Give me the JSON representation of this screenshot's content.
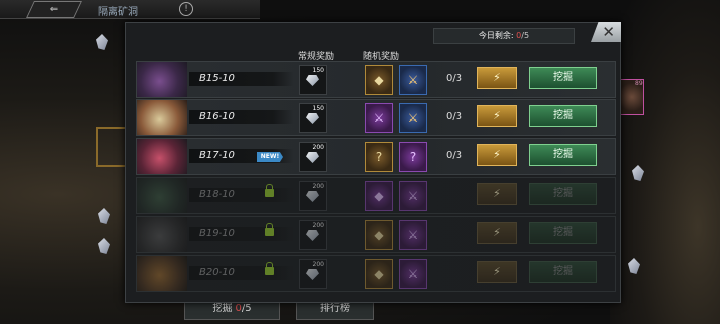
{
  "top_bar": {
    "back_label": "",
    "title": "隔离矿洞",
    "info_label": "!"
  },
  "bottom_buttons": {
    "dig_label": "挖掘",
    "dig_count": "/5",
    "rank_label": "排行榜"
  },
  "side_portrait": {
    "level": "89"
  },
  "modal": {
    "remaining_label": "今日剩余:",
    "remaining_current": "0",
    "remaining_total": "/5",
    "close_label": "✕",
    "col_normal": "常规奖励",
    "col_random": "随机奖励"
  },
  "rows": [
    {
      "name": "B15-10",
      "normal_qty": "150",
      "count": "0/3",
      "dig_label": "挖掘",
      "bolt": "⚡",
      "new": false,
      "locked": false
    },
    {
      "name": "B16-10",
      "normal_qty": "150",
      "count": "0/3",
      "dig_label": "挖掘",
      "bolt": "⚡",
      "new": false,
      "locked": false
    },
    {
      "name": "B17-10",
      "normal_qty": "200",
      "count": "0/3",
      "dig_label": "挖掘",
      "bolt": "⚡",
      "new": true,
      "new_label": "NEW!",
      "locked": false
    },
    {
      "name": "B18-10",
      "normal_qty": "200",
      "count": "",
      "dig_label": "挖掘",
      "bolt": "⚡",
      "new": false,
      "locked": true
    },
    {
      "name": "B19-10",
      "normal_qty": "200",
      "count": "",
      "dig_label": "挖掘",
      "bolt": "⚡",
      "new": false,
      "locked": true
    },
    {
      "name": "B20-10",
      "normal_qty": "200",
      "count": "",
      "dig_label": "挖掘",
      "bolt": "⚡",
      "new": false,
      "locked": true
    }
  ],
  "random_glyphs": {
    "unknown": "?",
    "sword": "⚔",
    "gem": "◆"
  }
}
